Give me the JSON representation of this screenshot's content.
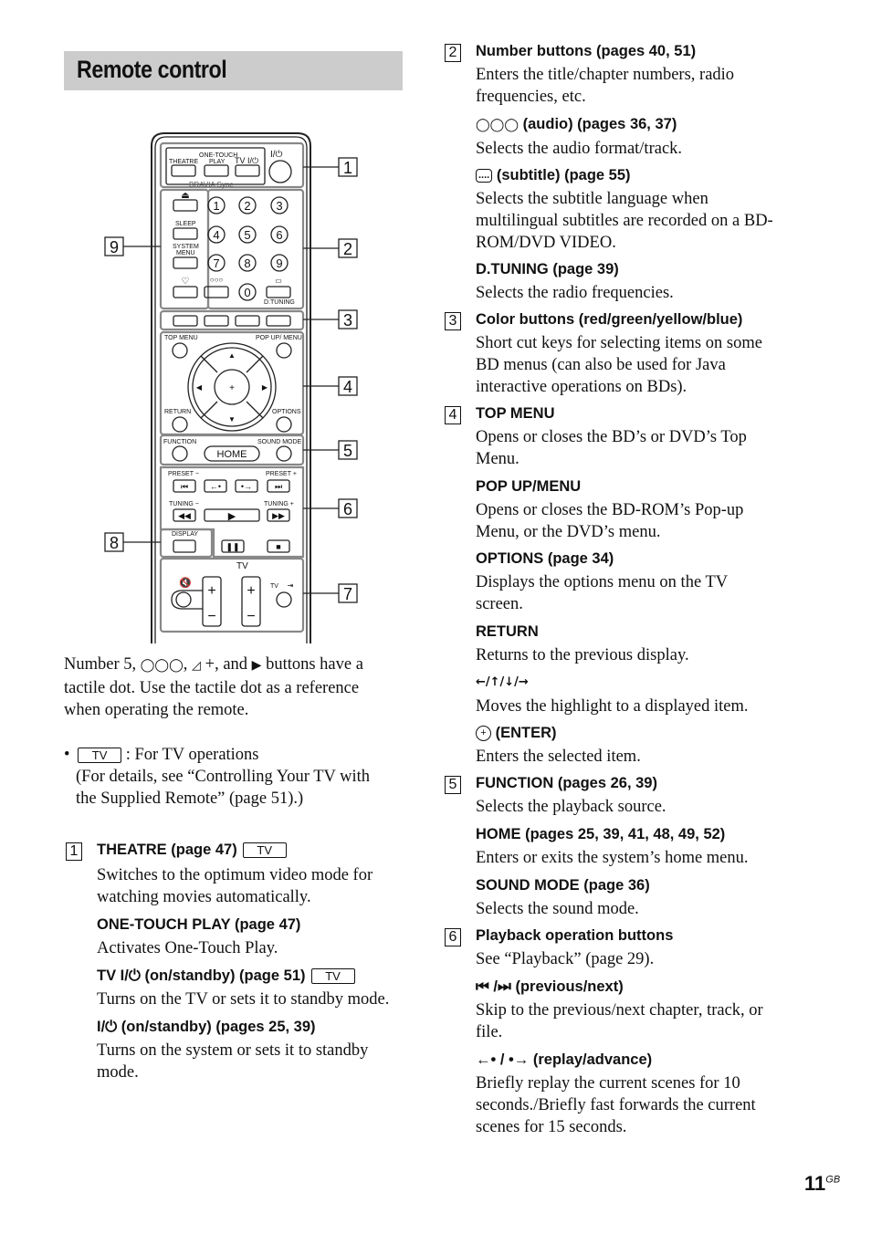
{
  "title": "Remote control",
  "remote": {
    "callouts": [
      "1",
      "2",
      "3",
      "4",
      "5",
      "6",
      "7",
      "8",
      "9"
    ],
    "labels": {
      "theatre": "THEATRE",
      "one_touch_play_1": "ONE-TOUCH",
      "one_touch_play_2": "PLAY",
      "tv_power": "TV I/⏻",
      "power": "I/⏻",
      "bravia_sync": "BRAVIA Sync",
      "sleep": "SLEEP",
      "system_menu_1": "SYSTEM",
      "system_menu_2": "MENU",
      "d_tuning": "D.TUNING",
      "top_menu": "TOP MENU",
      "pop_up_menu": "POP UP/ MENU",
      "return": "RETURN",
      "options": "OPTIONS",
      "function": "FUNCTION",
      "sound_mode": "SOUND MODE",
      "home": "HOME",
      "preset_minus": "PRESET −",
      "preset_plus": "PRESET +",
      "tuning_minus": "TUNING −",
      "tuning_plus": "TUNING +",
      "display": "DISPLAY",
      "tv_vol": "TV",
      "tv_input": "TV"
    },
    "numbers": [
      "1",
      "2",
      "3",
      "4",
      "5",
      "6",
      "7",
      "8",
      "9",
      "0"
    ]
  },
  "note": {
    "tactile_text": "Number 5, ⵔⵔⵔ, ◿ +, and ▶ buttons have a tactile dot. Use the tactile dot as a reference when operating the remote.",
    "tactile_line1_a": "Number 5,",
    "tactile_line1_b": ", ",
    "tactile_line1_c": " +, and ",
    "tactile_line1_d": " buttons have a",
    "tactile_line2": "tactile dot. Use the tactile dot as a reference",
    "tactile_line3": "when operating the remote.",
    "tv_box": "TV",
    "bullet_text": ": For TV operations",
    "bullet_line2": "(For details, see “Controlling Your TV with",
    "bullet_line3": "the Supplied Remote” (page 51).)"
  },
  "sections": {
    "s1": {
      "num": "1",
      "items": [
        {
          "head": "THEATRE (page 47)",
          "tv": "TV",
          "desc": [
            "Switches to the optimum video mode for",
            "watching movies automatically."
          ]
        },
        {
          "head": "ONE-TOUCH PLAY (page 47)",
          "desc": [
            "Activates One-Touch Play."
          ]
        },
        {
          "head": "TV I/⏻ (on/standby) (page 51)",
          "tv": "TV",
          "desc": [
            "Turns on the TV or sets it to standby mode."
          ]
        },
        {
          "head": "I/⏻ (on/standby) (pages 25, 39)",
          "desc": [
            "Turns on the system or sets it to standby",
            "mode."
          ]
        }
      ]
    },
    "s2": {
      "num": "2",
      "items": [
        {
          "head": "Number buttons (pages 40, 51)",
          "desc": [
            "Enters the title/chapter numbers, radio",
            "frequencies, etc."
          ]
        },
        {
          "head": "(audio) (pages 36, 37)",
          "icon": "audio-icon",
          "desc": [
            "Selects the audio format/track."
          ]
        },
        {
          "head": "(subtitle) (page 55)",
          "icon": "subtitle-icon",
          "desc": [
            "Selects the subtitle language when",
            "multilingual subtitles are recorded on a BD-",
            "ROM/DVD VIDEO."
          ]
        },
        {
          "head": "D.TUNING (page 39)",
          "desc": [
            "Selects the radio frequencies."
          ]
        }
      ]
    },
    "s3": {
      "num": "3",
      "items": [
        {
          "head": "Color buttons (red/green/yellow/blue)",
          "desc": [
            "Short cut keys for selecting items on some",
            "BD menus (can also be used for Java",
            "interactive operations on BDs)."
          ]
        }
      ]
    },
    "s4": {
      "num": "4",
      "items": [
        {
          "head": "TOP MENU",
          "desc": [
            "Opens or closes the BD’s or DVD’s Top",
            "Menu."
          ]
        },
        {
          "head": "POP UP/MENU",
          "desc": [
            "Opens or closes the BD-ROM’s Pop-up",
            "Menu, or the DVD’s menu."
          ]
        },
        {
          "head": "OPTIONS (page 34)",
          "desc": [
            "Displays the options menu on the TV",
            "screen."
          ]
        },
        {
          "head": "RETURN",
          "desc": [
            "Returns to the previous display."
          ]
        },
        {
          "head": "←/↑/↓/→",
          "desc": [
            "Moves the highlight to a displayed item."
          ]
        },
        {
          "head": "(ENTER)",
          "icon": "enter-icon",
          "desc": [
            "Enters the selected item."
          ]
        }
      ]
    },
    "s5": {
      "num": "5",
      "items": [
        {
          "head": "FUNCTION (pages 26, 39)",
          "desc": [
            "Selects the playback source."
          ]
        },
        {
          "head": "HOME (pages 25, 39, 41, 48, 49, 52)",
          "desc": [
            "Enters or exits the system’s home menu."
          ]
        },
        {
          "head": "SOUND MODE (page 36)",
          "desc": [
            "Selects the sound mode."
          ]
        }
      ]
    },
    "s6": {
      "num": "6",
      "items": [
        {
          "head": "Playback operation buttons",
          "desc": [
            "See “Playback” (page 29)."
          ]
        },
        {
          "head": "⏮ /⏭ (previous/next)",
          "desc": [
            "Skip to the previous/next chapter, track, or",
            "file."
          ]
        },
        {
          "head": "←• / •→  (replay/advance)",
          "desc": [
            "Briefly replay the current scenes for 10",
            "seconds./Briefly fast forwards the current",
            "scenes for 15 seconds."
          ]
        }
      ]
    }
  },
  "page": {
    "number": "11",
    "suffix": "GB"
  }
}
